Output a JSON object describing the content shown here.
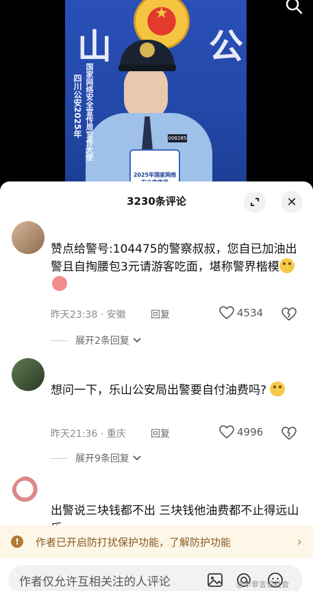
{
  "video": {
    "big_char_left": "山",
    "big_char_right": "公",
    "vertical_text_left": "四川公安2025年",
    "vertical_text_right": "国家网络安全宣传周宣传大使",
    "card_text": "2025年国家网络安全宣传周",
    "shoulder_tag": "008285"
  },
  "sheet": {
    "title": "3230条评论",
    "expand_icon": "expand-icon",
    "close_label": "✕"
  },
  "comments": [
    {
      "username": "",
      "text": "赞点给警号:104475的警察叔叔，您自已加油出警且自掏腰包3元请游客吃面，堪称警界楷模",
      "time_location": "昨天23:38 · 安徽",
      "reply_label": "回复",
      "likes": "4534",
      "expand_label": "展开2条回复"
    },
    {
      "username": "",
      "text": "想问一下，乐山公安局出警要自付油费吗?",
      "time_location": "昨天21:36 · 重庆",
      "reply_label": "回复",
      "likes": "4996",
      "expand_label": "展开9条回复"
    },
    {
      "username": "",
      "text": "出警说三块钱都不出 三块钱他油费都不止得远山乐"
    }
  ],
  "banner": {
    "text": "作者已开启防打扰保护功能，了解防护功能",
    "icon": "!"
  },
  "input": {
    "placeholder": "作者仅允许互相关注的人评论",
    "watermark": "@辛非言论社会"
  },
  "colors": {
    "banner_bg": "#fdf7e8",
    "banner_text": "#8a5a22",
    "video_blue": "#2348a8"
  }
}
